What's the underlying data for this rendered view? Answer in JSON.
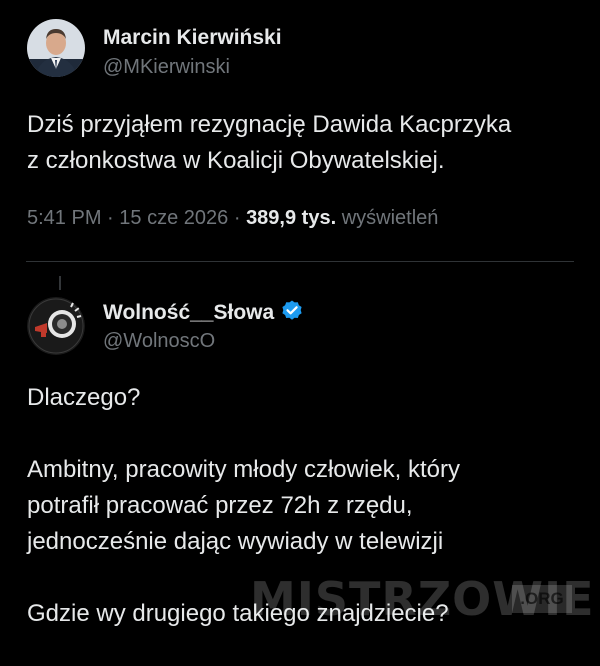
{
  "tweet": {
    "author_name": "Marcin Kierwiński",
    "author_handle": "@MKierwinski",
    "text": "Dziś przyjąłem rezygnację Dawida Kacprzyka\nz członkostwa w Koalicji Obywatelskiej.",
    "time": "5:41 PM",
    "separator": "·",
    "date": "15 cze 2026",
    "views_count": "389,9 tys.",
    "views_label": "wyświetleń"
  },
  "reply": {
    "author_name": "Wolność__Słowa",
    "author_handle": "@WolnoscO",
    "verified": true,
    "text": "Dlaczego?\n\nAmbitny, pracowity młody człowiek, który\npotrafił pracować przez 72h z rzędu,\njednocześnie dając wywiady w telewizji\n\nGdzie wy drugiego takiego znajdziecie?"
  },
  "watermark": {
    "text": "MISTRZOWIE",
    "suffix": ".ORG"
  },
  "colors": {
    "background": "#000000",
    "primary_text": "#e7e9ea",
    "secondary_text": "#71767b",
    "verified_badge": "#1d9bf0",
    "divider": "#2f3336"
  },
  "icons": {
    "verified": "verified-badge-icon"
  }
}
